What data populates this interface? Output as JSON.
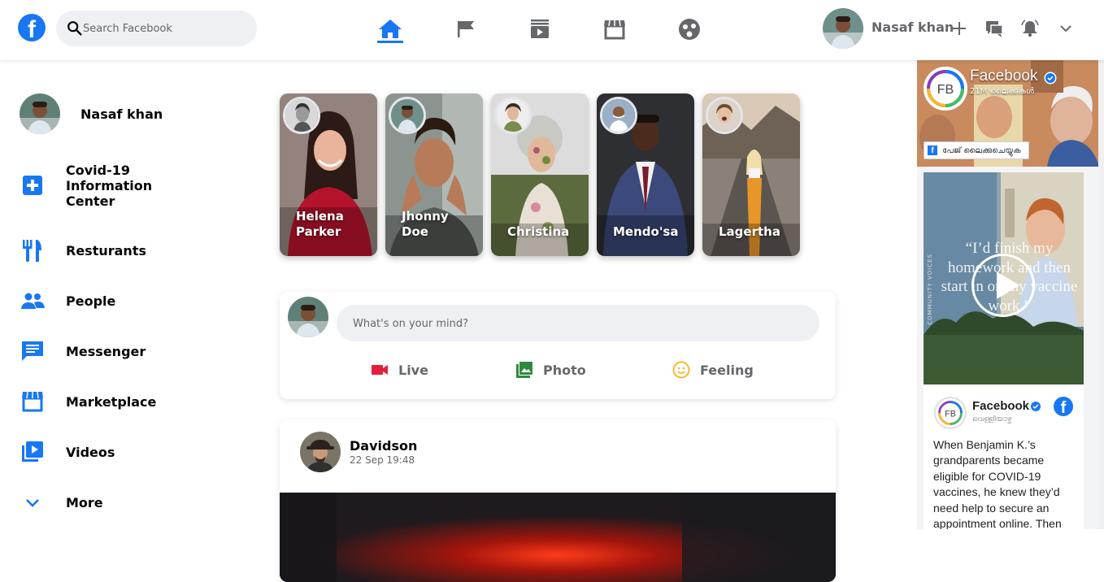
{
  "header": {
    "logo_letter": "f",
    "search_placeholder": "Search Facebook",
    "nav": [
      "home-icon",
      "flag-icon",
      "watch-icon",
      "marketplace-icon",
      "groups-icon"
    ],
    "user_name": "Nasaf khan",
    "actions": [
      "plus-icon",
      "messenger-icon",
      "notifications-icon",
      "chevron-down-icon"
    ],
    "accent": "#1877f2"
  },
  "sidebar": {
    "profile_name": "Nasaf khan",
    "items": [
      {
        "label": "Covid-19\nInformation\nCenter",
        "icon": "plus-square-icon"
      },
      {
        "label": "Resturants",
        "icon": "restaurant-icon"
      },
      {
        "label": "People",
        "icon": "people-icon"
      },
      {
        "label": "Messenger",
        "icon": "chat-icon"
      },
      {
        "label": "Marketplace",
        "icon": "store-icon"
      },
      {
        "label": "Videos",
        "icon": "video-library-icon"
      },
      {
        "label": "More",
        "icon": "chevron-down-icon"
      }
    ]
  },
  "stories": [
    {
      "name": "Helena Parker"
    },
    {
      "name": "Jhonny Doe"
    },
    {
      "name": "Christina"
    },
    {
      "name": "Mendo'sa"
    },
    {
      "name": "Lagertha"
    }
  ],
  "composer": {
    "placeholder": "What's on your mind?",
    "actions": [
      {
        "label": "Live",
        "color": "#e41e3f"
      },
      {
        "label": "Photo",
        "color": "#45bd62"
      },
      {
        "label": "Feeling",
        "color": "#f7b928"
      }
    ]
  },
  "post": {
    "author": "Davidson",
    "time": "22 Sep 19:48"
  },
  "right_panel": {
    "page_name": "Facebook",
    "page_logo_text": "FB",
    "page_likes": "21M ലൈക്കുകൾ",
    "like_button": "പേജ് ലൈക്കുചെയ്യുക",
    "video_side_text": "COMMUNITY VOICES",
    "video_quote": "“I’d finish my homework and then start in on my vaccine work.”",
    "card_name": "Facebook",
    "card_sub": "വെള്ളിയാഴ്ച",
    "card_text": "When Benjamin K.’s grandparents became eligible for COVID-19 vaccines, he knew they’d need help to secure an appointment online. Then"
  }
}
